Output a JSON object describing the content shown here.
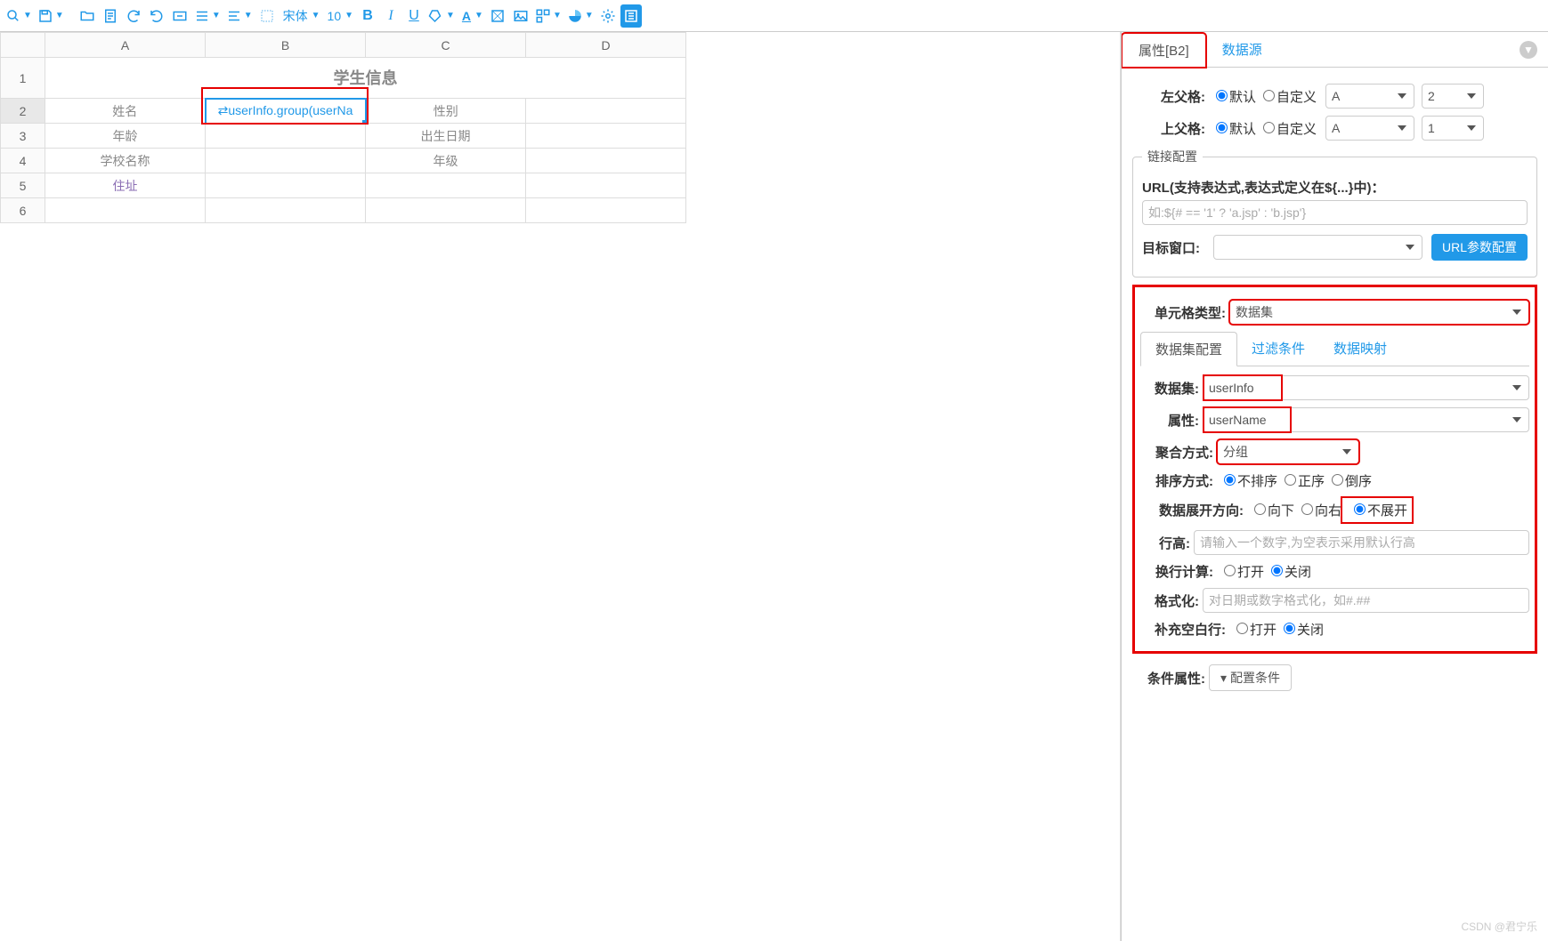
{
  "toolbar": {
    "font_name": "宋体",
    "font_size": "10",
    "bold": "B",
    "italic": "I",
    "underline": "U"
  },
  "sheet": {
    "cols": [
      "A",
      "B",
      "C",
      "D"
    ],
    "rows": [
      "1",
      "2",
      "3",
      "4",
      "5",
      "6"
    ],
    "b1": "学生信息",
    "a2": "姓名",
    "b2": "userInfo.group(userNa",
    "c2": "性别",
    "a3": "年龄",
    "c3": "出生日期",
    "a4": "学校名称",
    "c4": "年级",
    "a5": "住址"
  },
  "panel": {
    "tab_attr": "属性[B2]",
    "tab_ds": "数据源",
    "left_parent_label": "左父格:",
    "up_parent_label": "上父格:",
    "radio_default": "默认",
    "radio_custom": "自定义",
    "left_col": "A",
    "left_row": "2",
    "up_col": "A",
    "up_row": "1",
    "link_legend": "链接配置",
    "url_label": "URL(支持表达式,表达式定义在${...}中)：",
    "url_placeholder": "如:${# == '1' ? 'a.jsp' : 'b.jsp'}",
    "target_label": "目标窗口:",
    "url_param_btn": "URL参数配置",
    "cell_type_label": "单元格类型:",
    "cell_type_value": "数据集",
    "subtab_ds": "数据集配置",
    "subtab_filter": "过滤条件",
    "subtab_map": "数据映射",
    "ds_label": "数据集:",
    "ds_value": "userInfo",
    "attr_label": "属性:",
    "attr_value": "userName",
    "agg_label": "聚合方式:",
    "agg_value": "分组",
    "sort_label": "排序方式:",
    "sort_none": "不排序",
    "sort_asc": "正序",
    "sort_desc": "倒序",
    "expand_label": "数据展开方向:",
    "expand_down": "向下",
    "expand_right": "向右",
    "expand_none": "不展开",
    "rowh_label": "行高:",
    "rowh_placeholder": "请输入一个数字,为空表示采用默认行高",
    "wrap_label": "换行计算:",
    "wrap_on": "打开",
    "wrap_off": "关闭",
    "format_label": "格式化:",
    "format_placeholder": "对日期或数字格式化，如#.##",
    "fill_label": "补充空白行:",
    "fill_on": "打开",
    "fill_off": "关闭",
    "cond_label": "条件属性:",
    "cond_btn": "配置条件"
  },
  "watermark": "CSDN @君宁乐"
}
